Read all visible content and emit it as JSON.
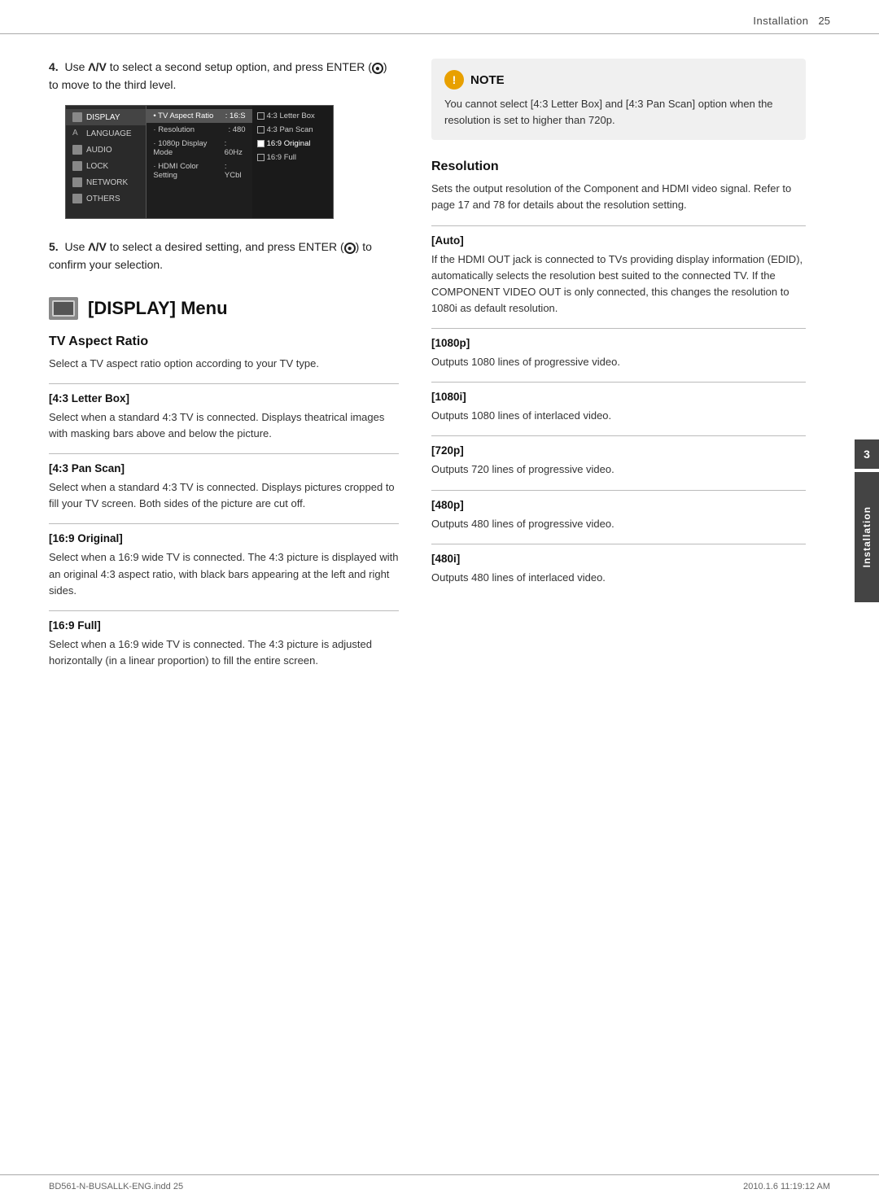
{
  "header": {
    "title": "Installation",
    "page_number": "25"
  },
  "side_tab": {
    "number": "3",
    "label": "Installation"
  },
  "steps": {
    "step4": {
      "text": "Use Λ/V to select a second setup option, and press ENTER (",
      "circle_symbol": "●",
      "text2": ") to move to the third level."
    },
    "step5": {
      "text": "Use Λ/V to select a desired setting, and press ENTER (",
      "circle_symbol": "●",
      "text2": ") to confirm your selection."
    }
  },
  "menu_screenshot": {
    "left_items": [
      {
        "label": "DISPLAY",
        "active": true
      },
      {
        "label": "LANGUAGE"
      },
      {
        "label": "AUDIO"
      },
      {
        "label": "LOCK"
      },
      {
        "label": "NETWORK"
      },
      {
        "label": "OTHERS"
      }
    ],
    "middle_items": [
      {
        "label": "• TV Aspect Ratio",
        "value": ": 16:S"
      },
      {
        "label": "· Resolution",
        "value": ": 480"
      },
      {
        "label": "· 1080p Display Mode",
        "value": ": 60Hz"
      },
      {
        "label": "· HDMI Color Setting",
        "value": ": YCbl"
      }
    ],
    "right_items": [
      {
        "label": "4:3 Letter Box",
        "checked": false
      },
      {
        "label": "4:3 Pan Scan",
        "checked": false
      },
      {
        "label": "16:9 Original",
        "checked": true
      },
      {
        "label": "16:9 Full",
        "checked": false
      }
    ]
  },
  "display_menu": {
    "title": "[DISPLAY] Menu",
    "tv_aspect_ratio": {
      "heading": "TV Aspect Ratio",
      "desc": "Select a TV aspect ratio option according to your TV type.",
      "items": [
        {
          "title": "[4:3 Letter Box]",
          "desc": "Select when a standard 4:3 TV is connected. Displays theatrical images with masking bars above and below the picture."
        },
        {
          "title": "[4:3 Pan Scan]",
          "desc": "Select when a standard 4:3 TV is connected. Displays pictures cropped to fill your TV screen. Both sides of the picture are cut off."
        },
        {
          "title": "[16:9 Original]",
          "desc": "Select when a 16:9 wide TV is connected. The 4:3 picture is displayed with an original 4:3 aspect ratio, with black bars appearing at the left and right sides."
        },
        {
          "title": "[16:9 Full]",
          "desc": "Select when a 16:9 wide TV is connected. The 4:3 picture is adjusted horizontally (in a linear proportion) to fill the entire screen."
        }
      ]
    }
  },
  "note": {
    "icon_label": "!",
    "title": "NOTE",
    "text": "You cannot select [4:3 Letter Box] and [4:3 Pan Scan] option when the resolution is set to higher than 720p."
  },
  "resolution": {
    "heading": "Resolution",
    "desc": "Sets the output resolution of the Component and HDMI video signal. Refer to page 17 and 78 for details about the resolution setting.",
    "items": [
      {
        "title": "[Auto]",
        "desc": "If the HDMI OUT jack is connected to TVs providing display information (EDID), automatically selects the resolution best suited to the connected TV. If the COMPONENT VIDEO OUT is only connected, this changes the resolution to 1080i as default resolution."
      },
      {
        "title": "[1080p]",
        "desc": "Outputs 1080 lines of progressive video."
      },
      {
        "title": "[1080i]",
        "desc": "Outputs 1080 lines of interlaced video."
      },
      {
        "title": "[720p]",
        "desc": "Outputs 720 lines of progressive video."
      },
      {
        "title": "[480p]",
        "desc": "Outputs 480 lines of progressive video."
      },
      {
        "title": "[480i]",
        "desc": "Outputs 480 lines of interlaced video."
      }
    ]
  },
  "footer": {
    "filename": "BD561-N-BUSALLK-ENG.indd   25",
    "date": "2010.1.6   11:19:12 AM"
  }
}
